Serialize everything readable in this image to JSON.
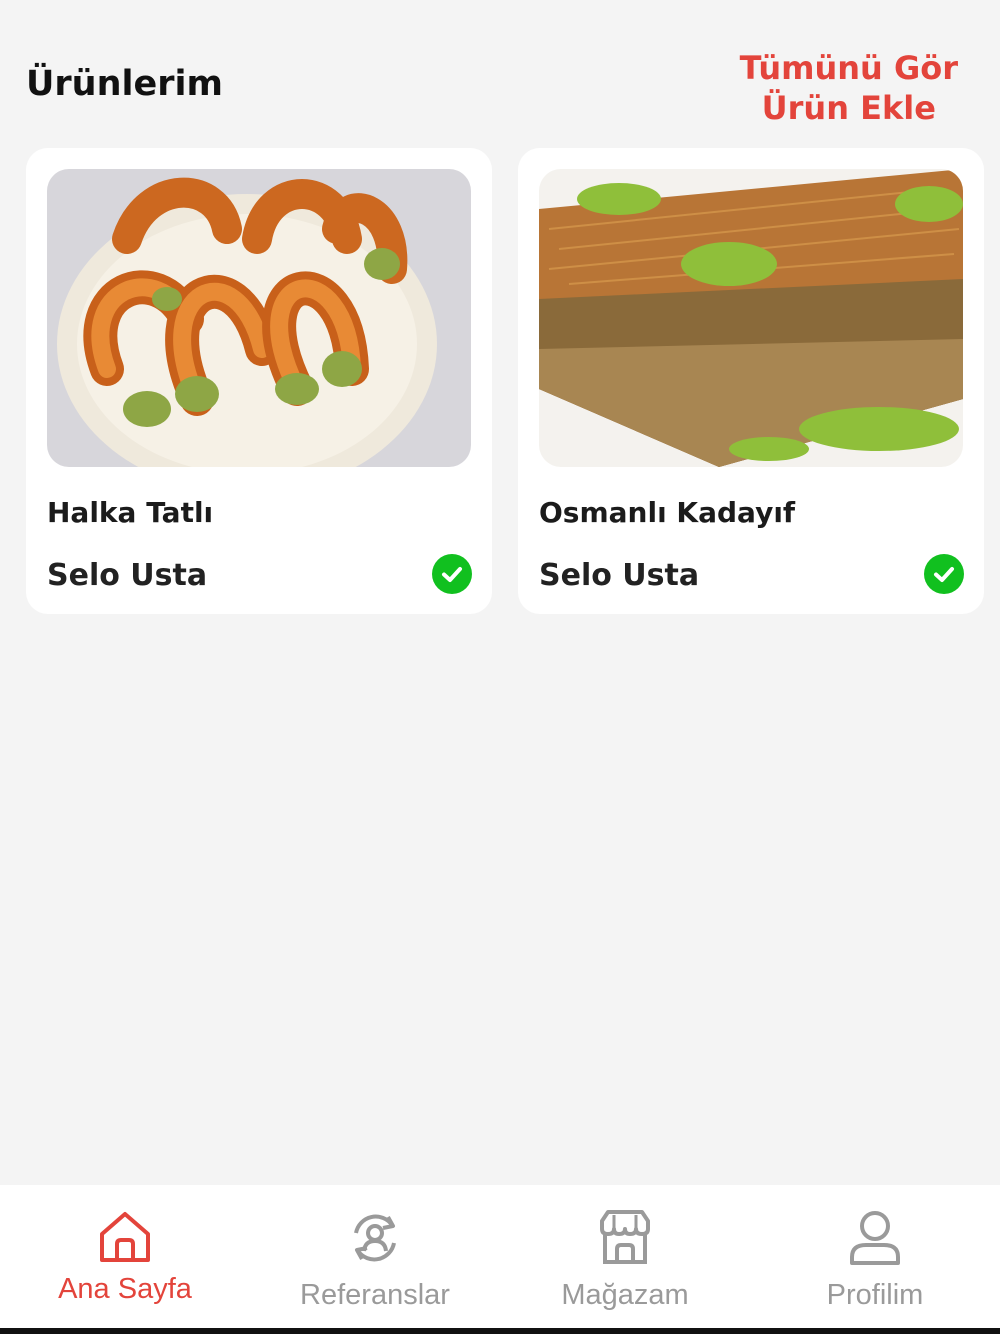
{
  "header": {
    "title": "Ürünlerim",
    "view_all_label": "Tümünü Gör",
    "add_product_label": "Ürün Ekle"
  },
  "products": [
    {
      "name": "Halka Tatlı",
      "seller": "Selo Usta",
      "approved": true,
      "image": "ring-dessert-photo"
    },
    {
      "name": "Osmanlı Kadayıf",
      "seller": "Selo Usta",
      "approved": true,
      "image": "kadayif-photo"
    }
  ],
  "bottom_nav": {
    "items": [
      {
        "label": "Ana Sayfa",
        "icon": "home-icon",
        "active": true
      },
      {
        "label": "Referanslar",
        "icon": "referrals-icon",
        "active": false
      },
      {
        "label": "Mağazam",
        "icon": "store-icon",
        "active": false
      },
      {
        "label": "Profilim",
        "icon": "profile-icon",
        "active": false
      }
    ]
  },
  "colors": {
    "accent": "#e3443b",
    "approved": "#11c01f",
    "inactive": "#9a9a9a",
    "background": "#f4f4f4"
  }
}
